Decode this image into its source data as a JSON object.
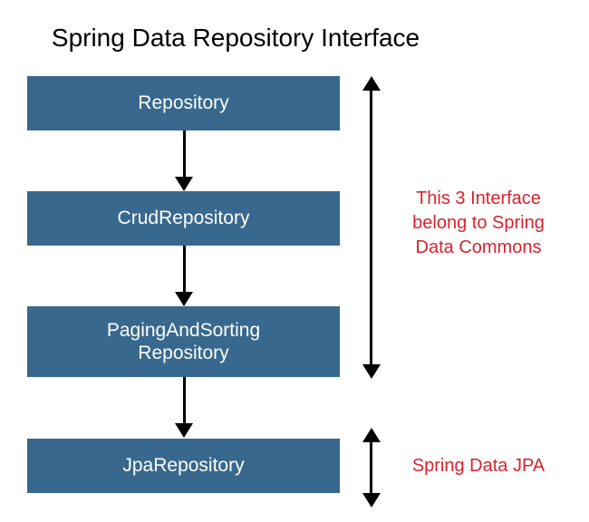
{
  "title": "Spring Data Repository Interface",
  "boxes": {
    "b1": "Repository",
    "b2": "CrudRepository",
    "b3": "PagingAndSorting\nRepository",
    "b4": "JpaRepository"
  },
  "annotations": {
    "commons": "This 3 Interface\nbelong to Spring\nData Commons",
    "jpa": "Spring Data JPA"
  },
  "colors": {
    "box_bg": "#38688e",
    "box_text": "#ffffff",
    "annotation": "#d9232e",
    "arrow": "#000000"
  }
}
